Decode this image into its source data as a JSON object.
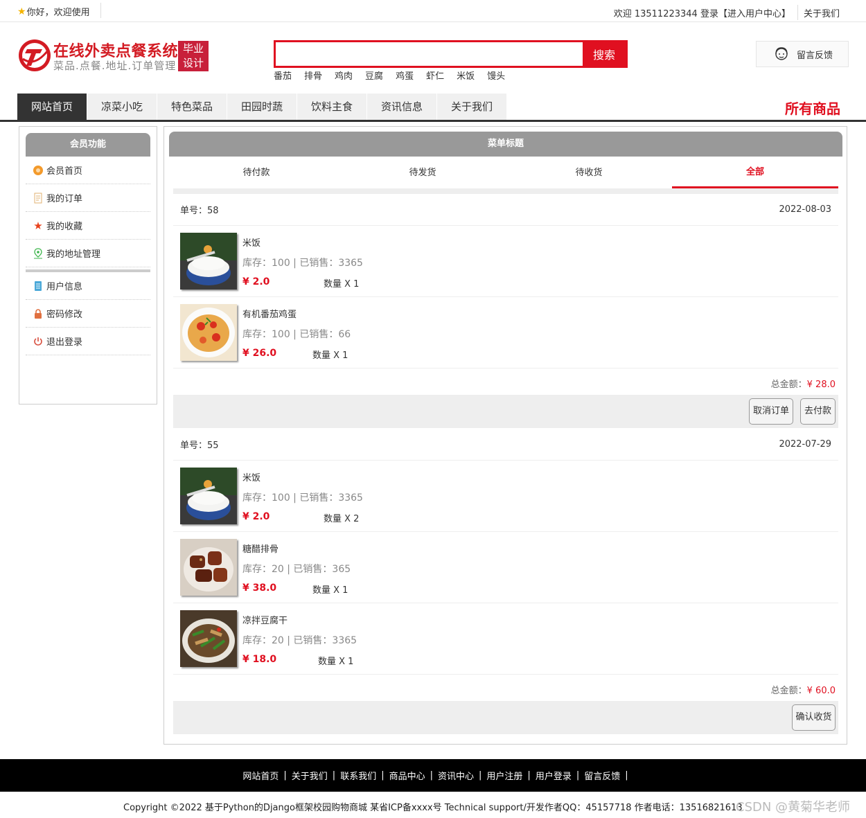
{
  "topbar": {
    "greeting": "你好，欢迎使用",
    "welcome_user": "欢迎 13511223344 登录",
    "user_center_link": "【进入用户中心】",
    "about_link": "关于我们"
  },
  "header": {
    "brand_title": "在线外卖点餐系统",
    "brand_subtitle": "菜品.点餐.地址.订单管理",
    "badge_line1": "毕业",
    "badge_line2": "设计",
    "search_placeholder": "",
    "search_button": "搜索",
    "hot_words": [
      "番茄",
      "排骨",
      "鸡肉",
      "豆腐",
      "鸡蛋",
      "虾仁",
      "米饭",
      "馒头"
    ],
    "feedback_label": "留言反馈"
  },
  "nav": {
    "items": [
      "网站首页",
      "凉菜小吃",
      "特色菜品",
      "田园时蔬",
      "饮料主食",
      "资讯信息",
      "关于我们"
    ],
    "active_index": 0,
    "all_goods": "所有商品"
  },
  "sidebar": {
    "title": "会员功能",
    "group1": [
      {
        "label": "会员首页",
        "icon": "home-icon"
      },
      {
        "label": "我的订单",
        "icon": "order-icon"
      },
      {
        "label": "我的收藏",
        "icon": "star-icon"
      },
      {
        "label": "我的地址管理",
        "icon": "address-icon"
      }
    ],
    "group2": [
      {
        "label": "用户信息",
        "icon": "user-info-icon"
      },
      {
        "label": "密码修改",
        "icon": "lock-icon"
      },
      {
        "label": "退出登录",
        "icon": "power-icon"
      }
    ]
  },
  "main": {
    "title": "菜单标题",
    "tabs": [
      "待付款",
      "待发货",
      "待收货",
      "全部"
    ],
    "active_tab": 3
  },
  "orders": [
    {
      "order_no_label": "单号：58",
      "date": "2022-08-03",
      "items": [
        {
          "name": "米饭",
          "stock": "库存：100 | 已销售：3365",
          "price": "¥ 2.0",
          "qty": "数量 X 1",
          "image": "rice-bowl"
        },
        {
          "name": "有机番茄鸡蛋",
          "stock": "库存：100 | 已销售：66",
          "price": "¥ 26.0",
          "qty": "数量 X 1",
          "image": "tomato-egg-noodles"
        }
      ],
      "total_label": "总金额：",
      "total": "¥ 28.0",
      "buttons": [
        "取消订单",
        "去付款"
      ]
    },
    {
      "order_no_label": "单号：55",
      "date": "2022-07-29",
      "items": [
        {
          "name": "米饭",
          "stock": "库存：100 | 已销售：3365",
          "price": "¥ 2.0",
          "qty": "数量 X 2",
          "image": "rice-bowl"
        },
        {
          "name": "糖醋排骨",
          "stock": "库存：20 | 已销售：365",
          "price": "¥ 38.0",
          "qty": "数量 X 1",
          "image": "sweet-sour-ribs"
        },
        {
          "name": "凉拌豆腐干",
          "stock": "库存：20 | 已销售：3365",
          "price": "¥ 18.0",
          "qty": "数量 X 1",
          "image": "cold-tofu"
        }
      ],
      "total_label": "总金额：",
      "total": "¥ 60.0",
      "buttons": [
        "确认收货"
      ]
    }
  ],
  "footer": {
    "links": [
      "网站首页",
      "关于我们",
      "联系我们",
      "商品中心",
      "资讯中心",
      "用户注册",
      "用户登录",
      "留言反馈"
    ],
    "copyright": "Copyright ©2022 基于Python的Django框架校园购物商城 某省ICP备xxxx号    Technical support/开发作者QQ：45157718     作者电话：13516821613",
    "watermark": "CSDN @黄菊华老师"
  },
  "colors": {
    "accent_red": "#e01020",
    "brand_red": "#d31b23",
    "nav_active": "#333333",
    "panel_gray": "#999999"
  }
}
